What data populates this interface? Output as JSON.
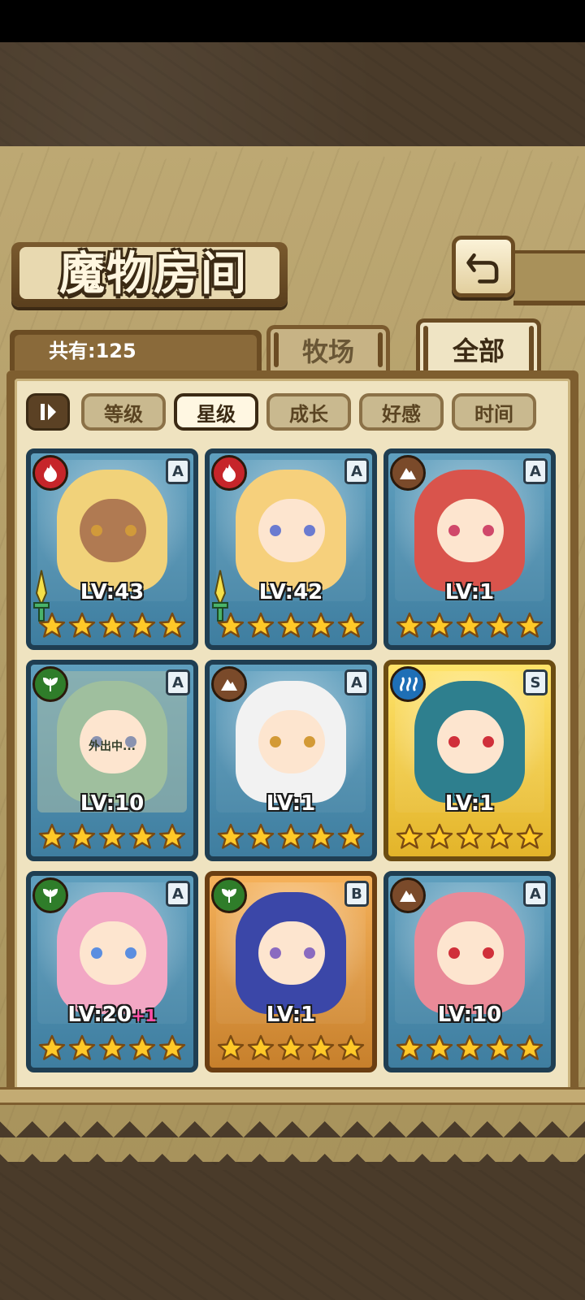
{
  "header": {
    "title": "魔物房间",
    "back_icon": "back-arrow-icon"
  },
  "summary": {
    "count_label": "共有:125"
  },
  "tabs": [
    {
      "label": "牧场",
      "selected": false
    },
    {
      "label": "全部",
      "selected": true
    }
  ],
  "sort": {
    "toggle_icon": "sort-order-icon",
    "options": [
      {
        "label": "等级",
        "selected": false
      },
      {
        "label": "星级",
        "selected": true
      },
      {
        "label": "成长",
        "selected": false
      },
      {
        "label": "好感",
        "selected": false
      },
      {
        "label": "时间",
        "selected": false
      }
    ]
  },
  "monsters": [
    {
      "element": "fire",
      "rank": "A",
      "level": "LV:43",
      "stars": 5,
      "frame": "blue",
      "weapon": true,
      "status": ""
    },
    {
      "element": "fire",
      "rank": "A",
      "level": "LV:42",
      "stars": 5,
      "frame": "blue",
      "weapon": true,
      "status": ""
    },
    {
      "element": "earth",
      "rank": "A",
      "level": "LV:1",
      "stars": 5,
      "frame": "blue",
      "weapon": false,
      "status": ""
    },
    {
      "element": "wood",
      "rank": "A",
      "level": "LV:10",
      "stars": 5,
      "frame": "blue",
      "weapon": false,
      "status": "外出中..."
    },
    {
      "element": "earth",
      "rank": "A",
      "level": "LV:1",
      "stars": 5,
      "frame": "blue",
      "weapon": false,
      "status": ""
    },
    {
      "element": "water",
      "rank": "S",
      "level": "LV:1",
      "stars": 5,
      "frame": "gold",
      "weapon": false,
      "status": ""
    },
    {
      "element": "wood",
      "rank": "A",
      "level": "LV:20",
      "level_bonus": "+1",
      "stars": 5,
      "frame": "blue",
      "weapon": false,
      "status": ""
    },
    {
      "element": "wood",
      "rank": "B",
      "level": "LV:1",
      "stars": 5,
      "frame": "orange",
      "weapon": false,
      "status": ""
    },
    {
      "element": "earth",
      "rank": "A",
      "level": "LV:10",
      "stars": 5,
      "frame": "blue",
      "weapon": false,
      "status": ""
    }
  ],
  "colors": {
    "fire": "#c6252a",
    "earth": "#7a4a2a",
    "wood": "#2f7d2a",
    "water": "#1e6fb6",
    "star": "#ffc928"
  }
}
